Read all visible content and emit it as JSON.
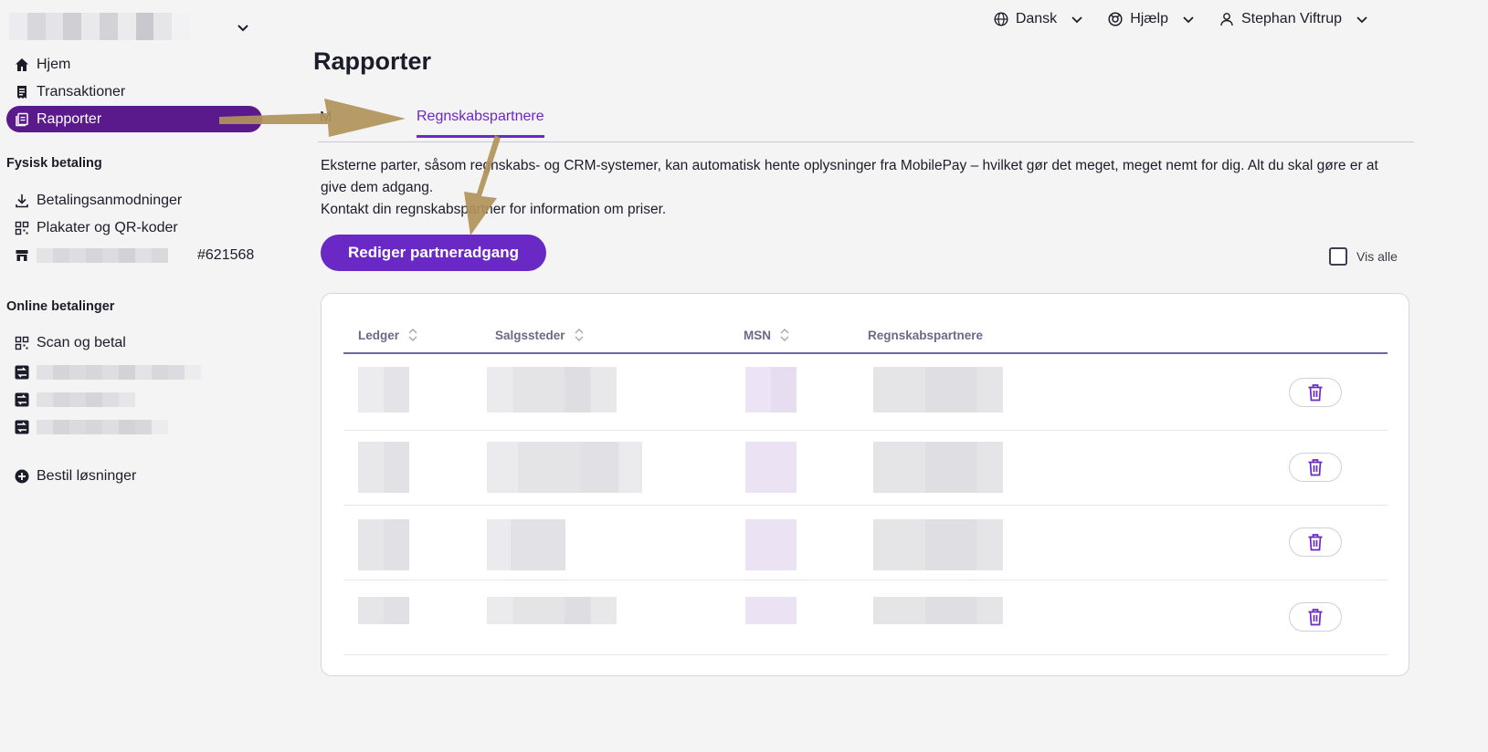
{
  "header": {
    "language_label": "Dansk",
    "help_label": "Hjælp",
    "user_name": "Stephan Viftrup"
  },
  "sidebar": {
    "nav": [
      {
        "label": "Hjem",
        "icon": "home-icon"
      },
      {
        "label": "Transaktioner",
        "icon": "receipt-icon"
      },
      {
        "label": "Rapporter",
        "icon": "reports-icon",
        "active": true
      }
    ],
    "physical_section_title": "Fysisk betaling",
    "physical_items": [
      {
        "label": "Betalingsanmodninger",
        "icon": "download-icon"
      },
      {
        "label": "Plakater og QR-koder",
        "icon": "qr-icon"
      }
    ],
    "store_number": "#621568",
    "online_section_title": "Online betalinger",
    "online_items": [
      {
        "label": "Scan og betal",
        "icon": "qr-icon"
      }
    ],
    "order_solutions_label": "Bestil løsninger"
  },
  "main": {
    "page_title": "Rapporter",
    "hidden_tab_fragment": "M",
    "active_tab": "Regnskabspartnere",
    "description_line1": "Eksterne parter, såsom regnskabs- og CRM-systemer, kan automatisk hente oplysninger fra MobilePay – hvilket gør det meget, meget nemt for dig. Alt du skal gøre er at give dem adgang.",
    "description_line2": "Kontakt din regnskabspartner for information om priser.",
    "edit_button_label": "Rediger partneradgang",
    "show_all_label": "Vis alle"
  },
  "table": {
    "columns": [
      "Ledger",
      "Salgssteder",
      "MSN",
      "Regnskabspartnere"
    ],
    "row_count": 4
  },
  "colors": {
    "accent": "#6a28c4",
    "sidebar_active": "#5a1a8c",
    "annotation_arrow": "#b0935a"
  }
}
